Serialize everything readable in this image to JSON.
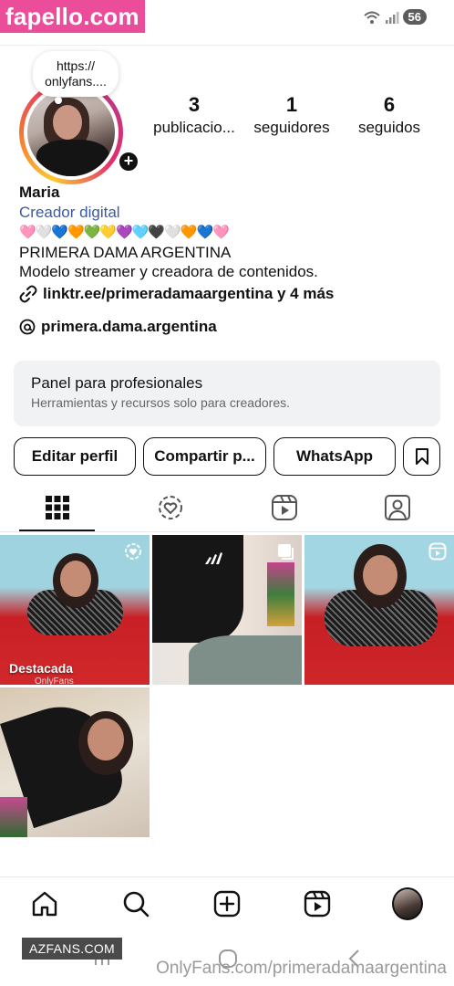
{
  "watermarks": {
    "top_left": "fapello.com",
    "bottom_left": "AZFANS.COM",
    "bottom_right": "OnlyFans.com/primeradamaargentina"
  },
  "status_bar": {
    "battery": "56",
    "icons": [
      "wifi-icon",
      "signal-icon",
      "battery-icon"
    ]
  },
  "profile": {
    "note": "https:// onlyfans....",
    "stats": [
      {
        "value": "3",
        "label": "publicacio..."
      },
      {
        "value": "1",
        "label": "seguidores"
      },
      {
        "value": "6",
        "label": "seguidos"
      }
    ],
    "name": "Maria",
    "category": "Creador digital",
    "hearts": "🩷🤍💙🧡💚💛💜🩵🖤🤍🧡💙🩷",
    "bio_line1": "PRIMERA DAMA ARGENTINA",
    "bio_line2": "Modelo streamer y creadora de contenidos.",
    "link": "linktr.ee/primeradamaargentina y 4 más",
    "threads": "primera.dama.argentina"
  },
  "panel": {
    "title": "Panel para profesionales",
    "subtitle": "Herramientas y recursos solo para creadores."
  },
  "buttons": {
    "edit": "Editar perfil",
    "share": "Compartir p...",
    "whatsapp": "WhatsApp"
  },
  "tabs": [
    "grid-icon",
    "collab-icon",
    "reels-icon",
    "tagged-icon"
  ],
  "grid": {
    "pinned_label": "Destacada",
    "onlyfans_tag": "OnlyFans"
  },
  "bottom_nav": [
    "home-icon",
    "search-icon",
    "create-icon",
    "reels-icon",
    "profile-avatar"
  ],
  "colors": {
    "link_blue": "#3a5ba0",
    "panel_bg": "#f1f2f4",
    "watermark_pink": "#ec4d9a"
  }
}
